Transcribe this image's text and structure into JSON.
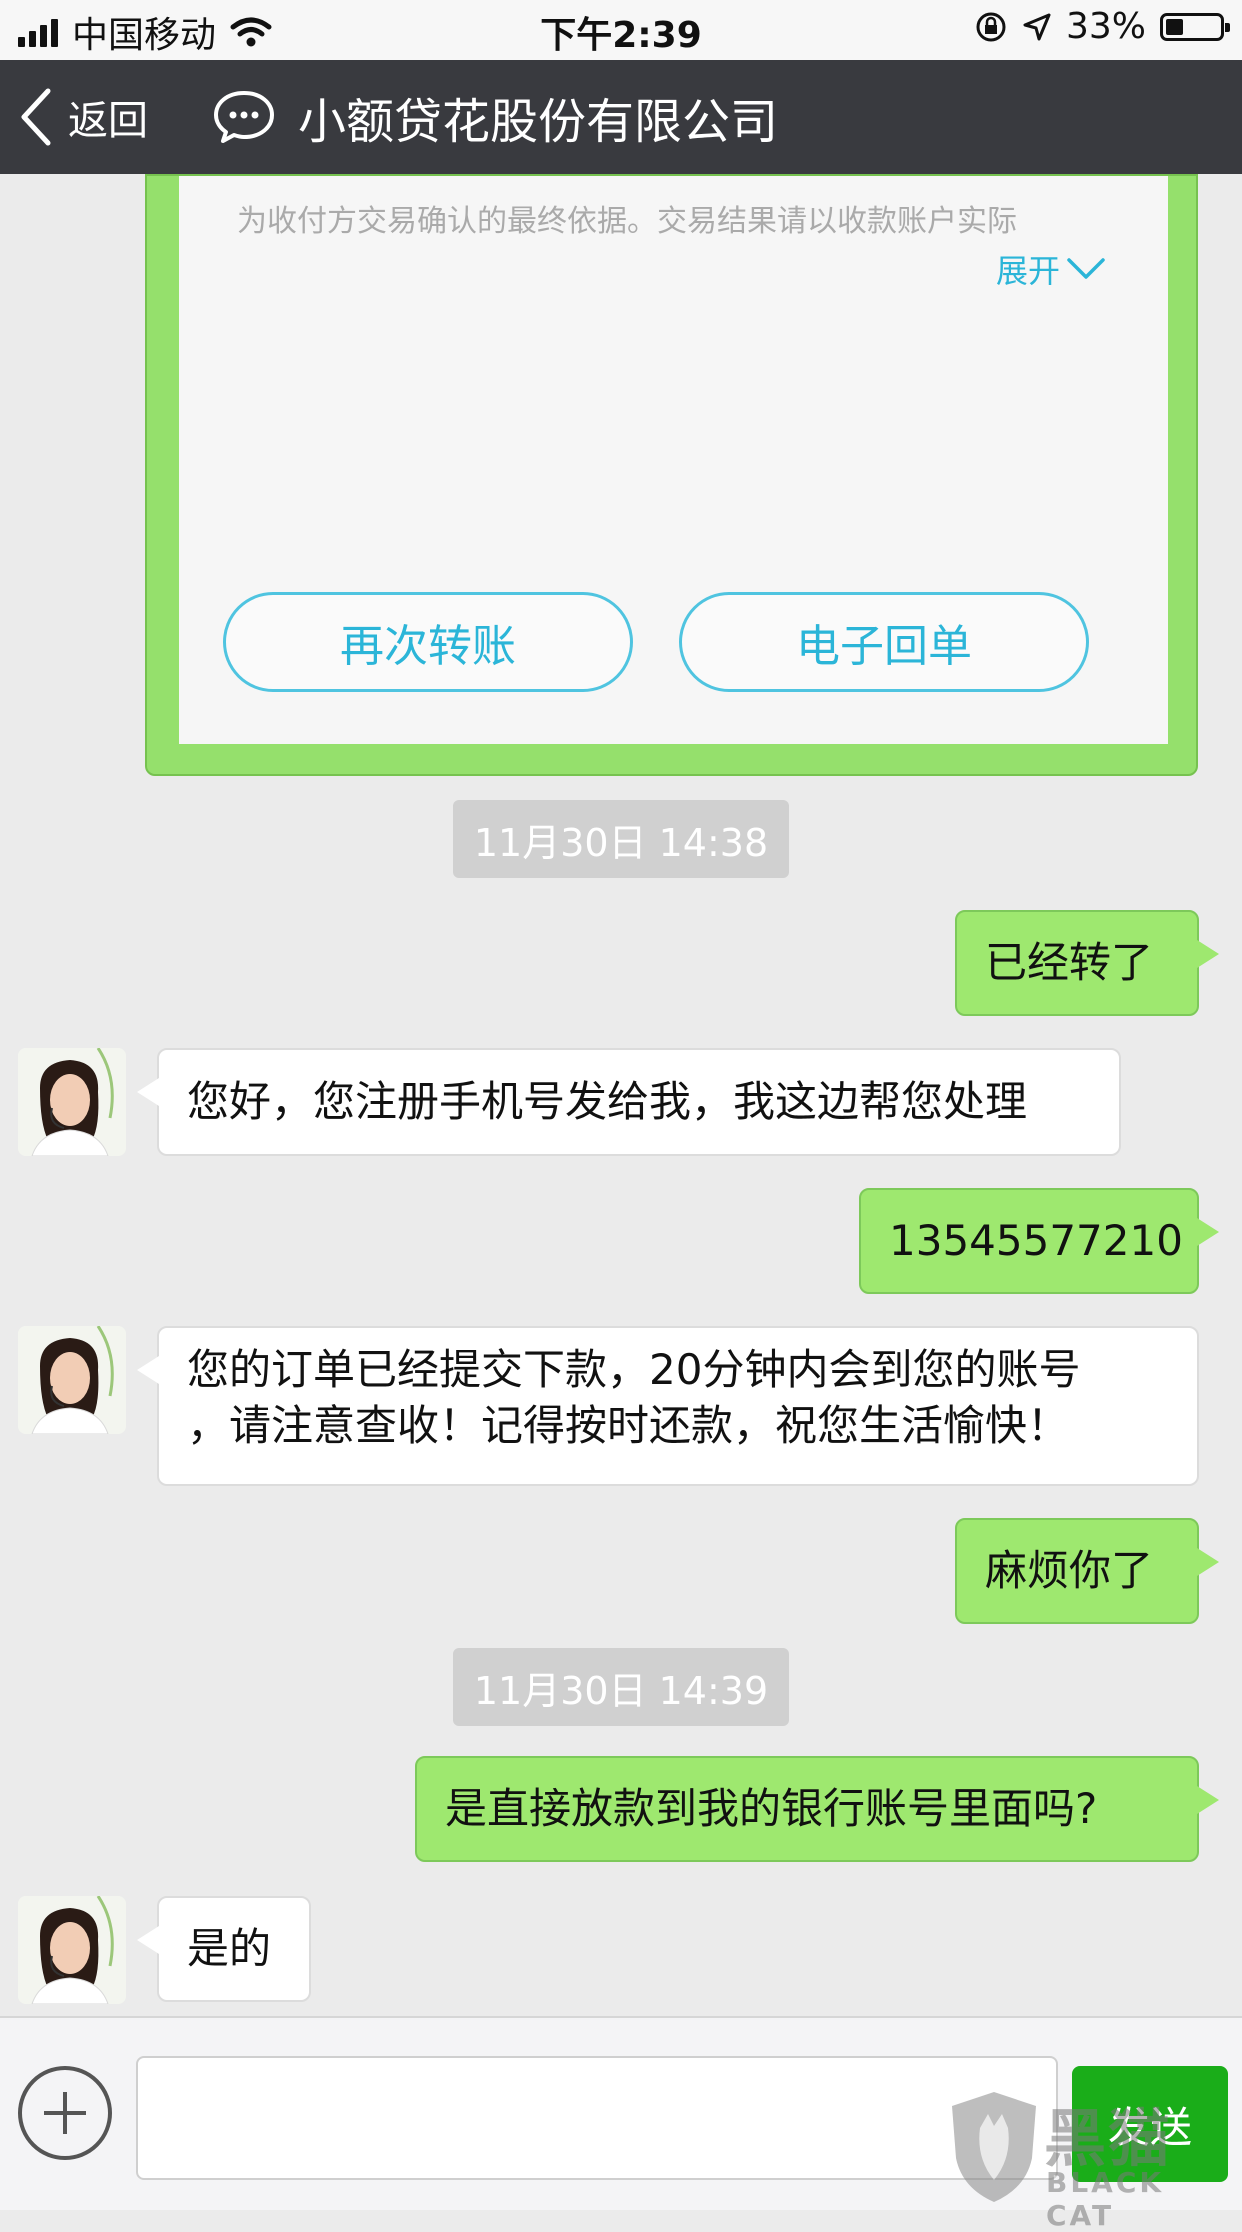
{
  "status_bar": {
    "carrier": "中国移动",
    "time": "下午2:39",
    "battery": "33%",
    "battery_level": 0.33
  },
  "nav": {
    "back_label": "返回",
    "title": "小额贷花股份有限公司"
  },
  "receipt": {
    "note": "为收付方交易确认的最终依据。交易结果请以收款账户实际",
    "expand_label": "展开",
    "transfer_again_label": "再次转账",
    "e_receipt_label": "电子回单"
  },
  "messages": {
    "ts1": "11月30日 14:38",
    "m1": "已经转了",
    "m2": "您好，您注册手机号发给我，我这边帮您处理",
    "m3": "13545577210",
    "m4_line1": "您的订单已经提交下款，20分钟内会到您的账号",
    "m4_line2": "，请注意查收！记得按时还款，祝您生活愉快！",
    "m5": "麻烦你了",
    "ts2": "11月30日 14:39",
    "m6": "是直接放款到我的银行账号里面吗?",
    "m7": "是的"
  },
  "input_bar": {
    "value": "",
    "send_label": "发送"
  },
  "watermark": {
    "logo_text": "黑猫",
    "sub_text": "BLACK CAT"
  }
}
